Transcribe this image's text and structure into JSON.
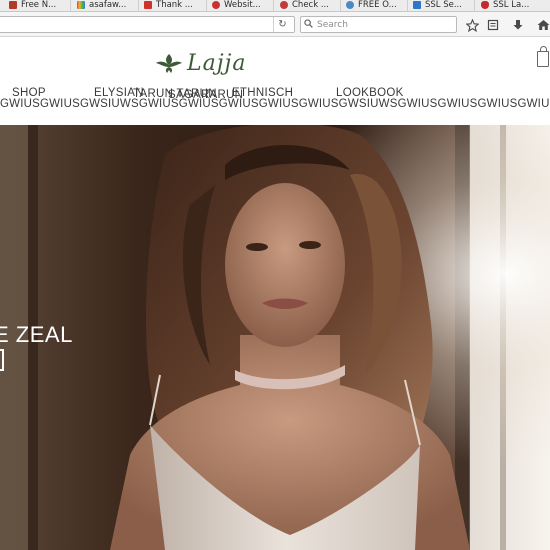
{
  "browser": {
    "bookmarks": [
      {
        "label": "Free N...",
        "color": "#b13b2a"
      },
      {
        "label": "asafaw...",
        "color": "#e8a33a"
      },
      {
        "label": "Thank ...",
        "color": "#d0302a"
      },
      {
        "label": "Websit...",
        "color": "#cc2f2f"
      },
      {
        "label": "Check ...",
        "color": "#c23a3a"
      },
      {
        "label": "FREE O...",
        "color": "#4a8ac9"
      },
      {
        "label": "SSL Se...",
        "color": "#2a78c7"
      },
      {
        "label": "SSL La...",
        "color": "#c42a2a"
      }
    ],
    "reload_glyph": "↻",
    "search_placeholder": "Search",
    "toolbar_icons": [
      "star-icon",
      "reader-icon",
      "download-icon",
      "home-icon"
    ]
  },
  "site": {
    "logo_text": "Lajja",
    "logo_color": "#3d5a36",
    "menu": {
      "shop": "SHOP",
      "elysian": "ELYSIAN",
      "tarun": "TARUN TARUN",
      "sagar": "SAGAR",
      "tarun2": "TARUN",
      "ethnisch": "ETHNISCH",
      "lookbook": "LOOKBOOK"
    },
    "gibberish_line": "GWIUSGWIUSGWSIUWSGWIUSGWIUSGWIUSGWIUSGWIUSGWSIUWSGWIUSGWIUSGWIUSGWIUSGWIUSGWIUSGW"
  },
  "hero": {
    "caption": "E ZEAL"
  }
}
